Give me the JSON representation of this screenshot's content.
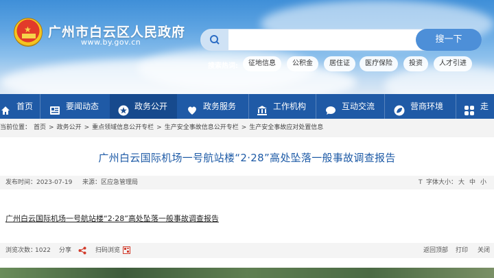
{
  "header": {
    "site_title": "广州市白云区人民政府",
    "site_url": "www.by.gov.cn"
  },
  "search": {
    "placeholder": "",
    "button_label": "搜一下",
    "hot_label": "搜索热词:",
    "hot_terms": [
      "征地信息",
      "公积金",
      "居住证",
      "医疗保险",
      "投资",
      "人才引进"
    ]
  },
  "nav": {
    "items": [
      {
        "label": "首页",
        "icon": "home-icon"
      },
      {
        "label": "要闻动态",
        "icon": "news-icon"
      },
      {
        "label": "政务公开",
        "icon": "star-icon"
      },
      {
        "label": "政务服务",
        "icon": "heart-icon"
      },
      {
        "label": "工作机构",
        "icon": "building-icon"
      },
      {
        "label": "互动交流",
        "icon": "chat-icon"
      },
      {
        "label": "营商环境",
        "icon": "leaf-icon"
      },
      {
        "label": "走进",
        "icon": "grid-icon"
      }
    ],
    "active_index": 2
  },
  "breadcrumb": {
    "label": "当前位置：",
    "items": [
      "首页",
      "政务公开",
      "重点领域信息公开专栏",
      "生产安全事故信息公开专栏",
      "生产安全事故应对处置信息"
    ]
  },
  "article": {
    "title": "广州白云国际机场一号航站楼“2·28”高处坠落一般事故调查报告",
    "publish_time": "发布时间：2023-07-19",
    "source": "来源：区应急管理局",
    "font_size_label": "字体大小：",
    "font_sizes": [
      "大",
      "中",
      "小"
    ],
    "body_link": "广州白云国际机场一号航站楼“2·28”高处坠落一般事故调查报告"
  },
  "footer": {
    "views": "浏览次数：",
    "views_count": "1022",
    "share": "分享",
    "scan": "扫码浏览",
    "back_top": "返回顶部",
    "print": "打印",
    "close": "关闭"
  }
}
